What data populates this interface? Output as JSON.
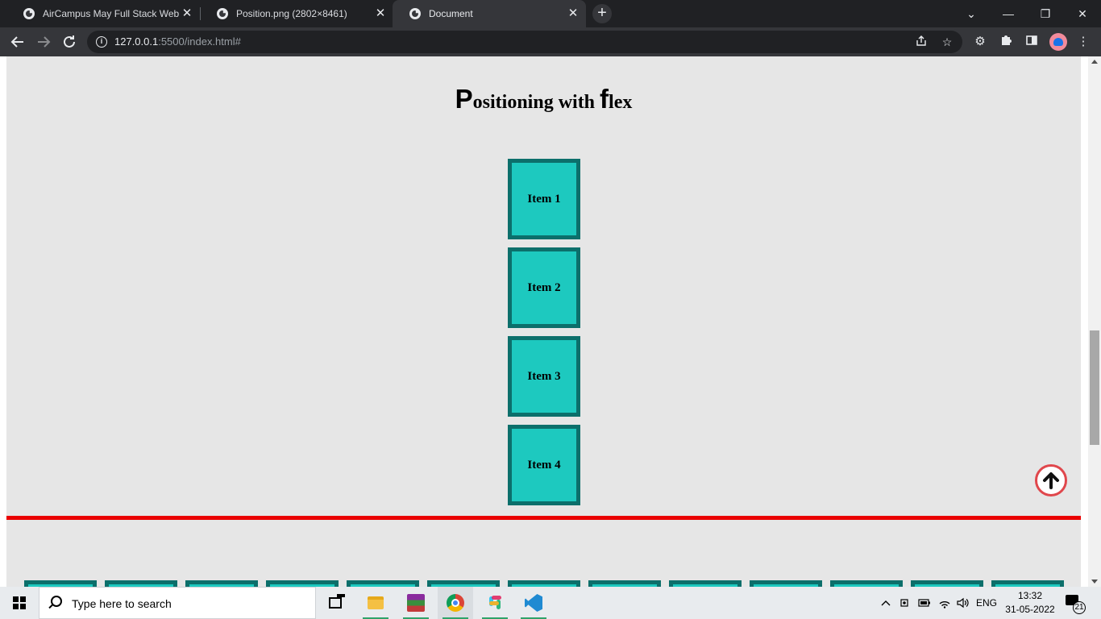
{
  "browser": {
    "tabs": [
      {
        "title": "AirCampus May Full Stack Web D",
        "active": false
      },
      {
        "title": "Position.png (2802×8461)",
        "active": false
      },
      {
        "title": "Document",
        "active": true
      }
    ],
    "new_tab_label": "+",
    "tab_close_glyph": "✕",
    "window_controls": {
      "tab_search": "⌄",
      "minimize": "—",
      "restore": "❐",
      "close": "✕"
    },
    "url_host": "127.0.0.1",
    "url_rest": ":5500/index.html#",
    "toolbar_icons": [
      "share-icon",
      "bookmark-star-icon",
      "extension-gear-icon",
      "extensions-puzzle-icon",
      "side-panel-icon",
      "profile-avatar",
      "kebab-menu-icon"
    ]
  },
  "page": {
    "title_first_letter": "P",
    "title_middle": "ositioning with ",
    "title_second_big": "f",
    "title_end": "lex",
    "items": [
      "Item 1",
      "Item 2",
      "Item 3",
      "Item 4"
    ],
    "back_to_top_glyph": "🡅",
    "colors": {
      "item_fill": "#1dc9bf",
      "item_border": "#0c6f6b",
      "divider": "#ea0000",
      "page_bg": "#e6e6e6"
    }
  },
  "taskbar": {
    "search_placeholder": "Type here to search",
    "pinned_apps": [
      "task-view",
      "file-explorer",
      "winrar",
      "chrome",
      "slack",
      "vscode"
    ],
    "tray": {
      "language": "ENG",
      "time": "13:32",
      "date": "31-05-2022",
      "notification_count": "21"
    }
  }
}
